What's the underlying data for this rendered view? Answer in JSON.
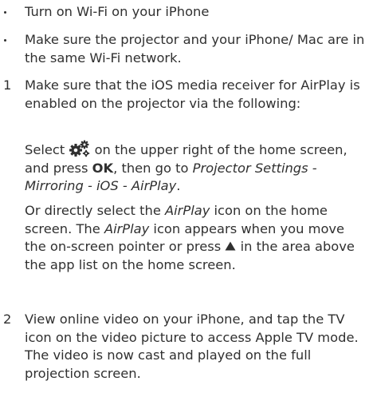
{
  "bullets": [
    {
      "marker": "•",
      "text": "Turn on Wi-Fi on your iPhone"
    },
    {
      "marker": "•",
      "text": "Make sure the projector and your iPhone/ Mac are in the same Wi-Fi network."
    }
  ],
  "steps": [
    {
      "number": "1",
      "text": "Make sure that the iOS media receiver for AirPlay is enabled on the projector via the following:",
      "select_para": {
        "lead": "Select",
        "icon": "settings-gear-icon",
        "after_icon": " on the upper right of the home screen, and press ",
        "ok": "OK",
        "mid": ", then go to ",
        "path": "Projector Settings - Mirroring - iOS - AirPlay",
        "end": "."
      },
      "airplay_para": {
        "part1": "Or directly select the ",
        "airplay1": "AirPlay",
        "part2": " icon on the home screen. The ",
        "airplay2": "AirPlay",
        "part3": " icon appears when you move the on-screen pointer or press ",
        "icon": "up-triangle-icon",
        "part4": " in the area above the app list on the home screen."
      }
    },
    {
      "number": "2",
      "text": "View online video on your iPhone, and tap the TV icon on the video picture to access Apple TV mode. The video is now cast and played on the full projection screen."
    }
  ]
}
